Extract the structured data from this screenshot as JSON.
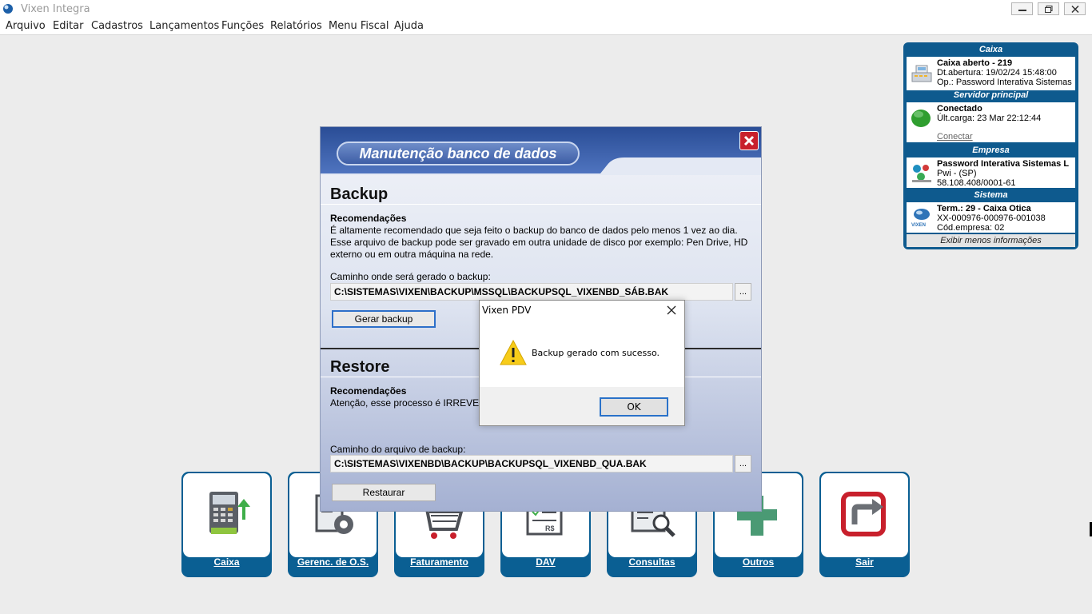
{
  "window": {
    "title": "Vixen Integra"
  },
  "menu": [
    "Arquivo",
    "Editar",
    "Cadastros",
    "Lançamentos",
    "Funções",
    "Relatórios",
    "Menu Fiscal",
    "Ajuda"
  ],
  "info_panel": {
    "caixa": {
      "header": "Caixa",
      "line1": "Caixa aberto - 219",
      "line2": "Dt.abertura: 19/02/24 15:48:00",
      "line3": "Op.: Password Interativa Sistemas"
    },
    "servidor": {
      "header": "Servidor principal",
      "line1": "Conectado",
      "line2": "Últ.carga: 23 Mar 22:12:44",
      "link": "Conectar"
    },
    "empresa": {
      "header": "Empresa",
      "line1": "Password Interativa Sistemas L",
      "line2": "Pwi - (SP)",
      "line3": "58.108.408/0001-61"
    },
    "sistema": {
      "header": "Sistema",
      "line1": "Term.: 29 - Caixa Otica",
      "line2": "XX-000976-000976-001038",
      "line3": "Cód.empresa: 02",
      "logo_text": "VIXEN"
    },
    "footer": "Exibir menos informações"
  },
  "dialog": {
    "title": "Manutenção banco de dados",
    "backup": {
      "title": "Backup",
      "rec_label": "Recomendações",
      "rec_line1": "É altamente recomendado que seja feito o backup do banco de dados pelo menos 1 vez ao dia.",
      "rec_line2": "Esse arquivo de backup pode ser gravado em outra unidade de disco por exemplo: Pen Drive, HD",
      "rec_line3": "externo ou em outra máquina na rede.",
      "path_label": "Caminho onde será gerado o backup:",
      "path": "C:\\SISTEMAS\\VIXEN\\BACKUP\\MSSQL\\BACKUPSQL_VIXENBD_SÁB.BAK",
      "browse": "...",
      "button": "Gerar backup"
    },
    "restore": {
      "title": "Restore",
      "rec_label": "Recomendações",
      "rec_line1": "Atenção, esse processo é IRREVE",
      "path_label": "Caminho do arquivo de backup:",
      "path": "C:\\SISTEMAS\\VIXENBD\\BACKUP\\BACKUPSQL_VIXENBD_QUA.BAK",
      "browse": "...",
      "button": "Restaurar"
    }
  },
  "message_box": {
    "title": "Vixen PDV",
    "text": "Backup gerado com sucesso.",
    "ok": "OK"
  },
  "bottom_buttons": [
    {
      "label": "Caixa",
      "icon": "cash-register-icon"
    },
    {
      "label": "Gerenc. de O.S.",
      "icon": "document-gear-icon"
    },
    {
      "label": "Faturamento",
      "icon": "shopping-cart-icon"
    },
    {
      "label": "DAV",
      "icon": "receipt-icon"
    },
    {
      "label": "Consultas",
      "icon": "search-document-icon"
    },
    {
      "label": "Outros",
      "icon": "plus-icon"
    },
    {
      "label": "Sair",
      "icon": "exit-icon"
    }
  ],
  "colors": {
    "accent": "#0a5f93",
    "close_red": "#c8202c",
    "status_green": "#2f9e2f"
  }
}
